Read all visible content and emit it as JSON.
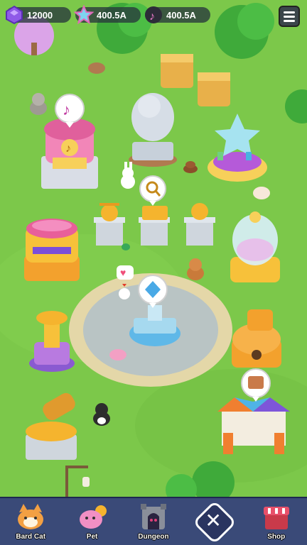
{
  "hud": {
    "gems": "12000",
    "stars": "400.5A",
    "notes": "400.5A"
  },
  "nav": {
    "items": [
      {
        "label": "Bard Cat"
      },
      {
        "label": "Pet"
      },
      {
        "label": "Dungeon"
      },
      {
        "label": ""
      },
      {
        "label": "Shop"
      }
    ]
  },
  "colors": {
    "grass": "#7cc84a",
    "plaza": "#b9c4c4",
    "nav_bg": "#3a4a78",
    "hud_pill": "#28373c"
  }
}
